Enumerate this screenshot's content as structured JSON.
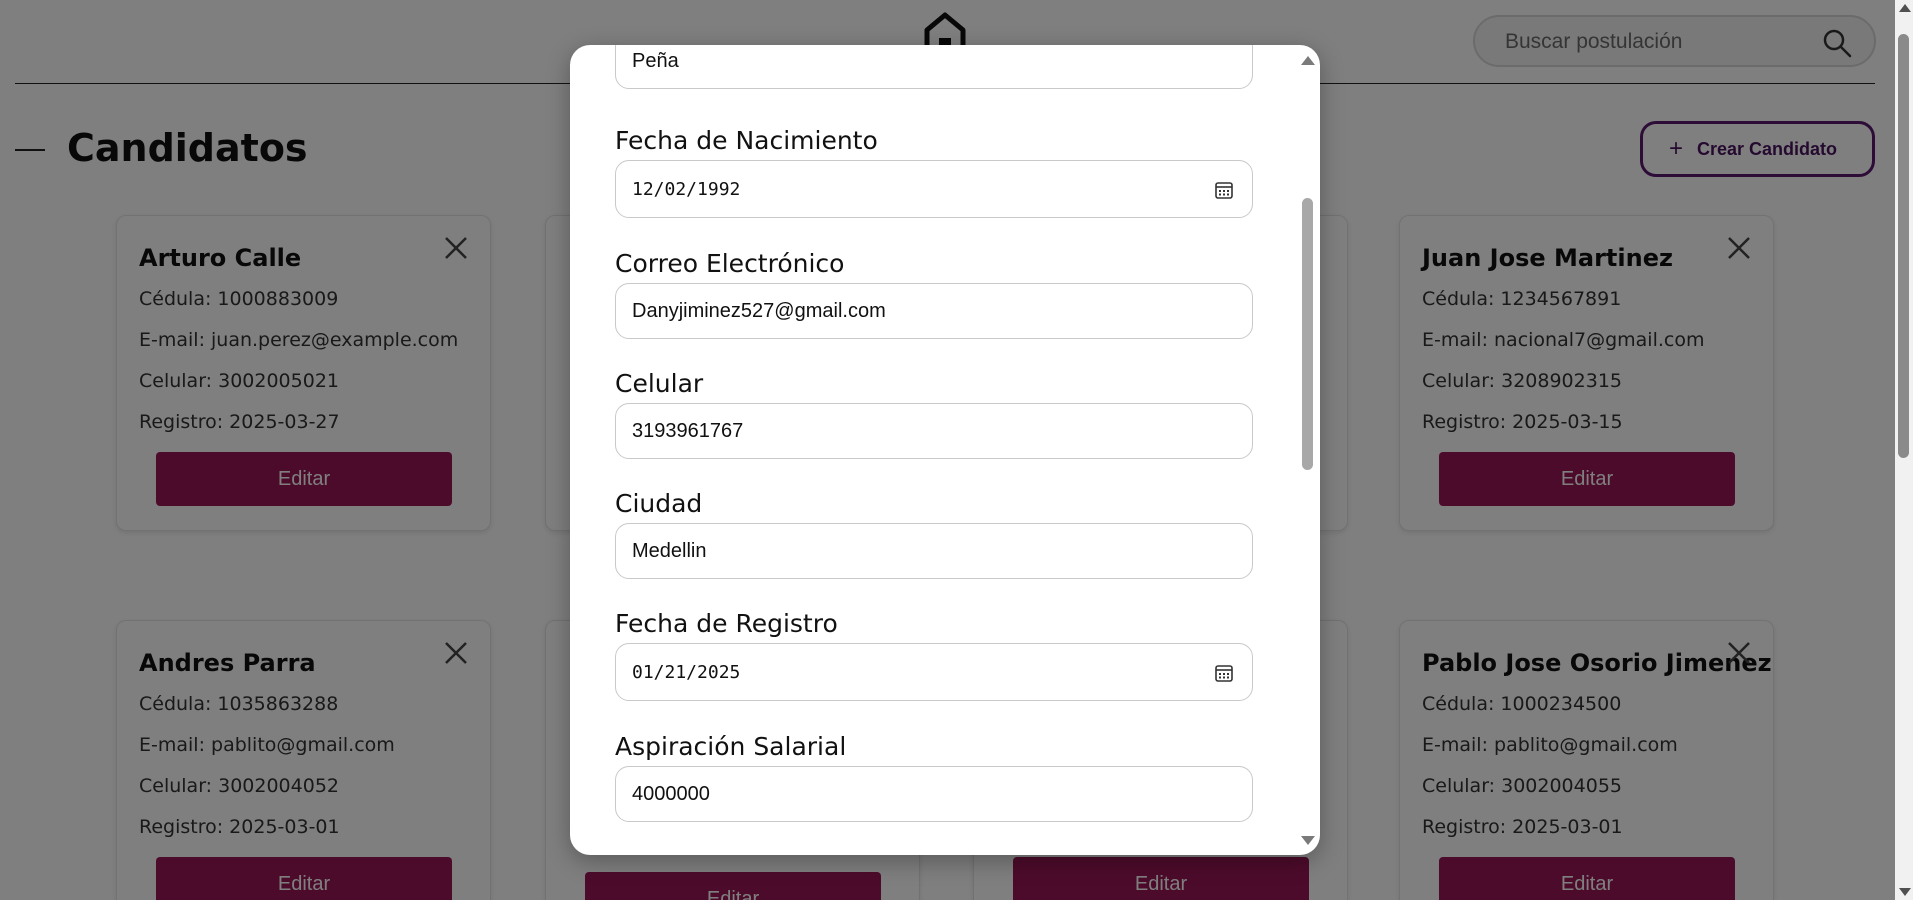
{
  "header": {
    "search_placeholder": "Buscar postulación",
    "page_title": "Candidatos",
    "create_label": "Crear Candidato"
  },
  "cards": [
    {
      "name": "Arturo Calle",
      "cedula": "Cédula: 1000883009",
      "email": "E-mail: juan.perez@example.com",
      "celular": "Celular: 3002005021",
      "registro": "Registro: 2025-03-27",
      "edit": "Editar"
    },
    {
      "name": "Juan Jose Martinez",
      "cedula": "Cédula: 1234567891",
      "email": "E-mail: nacional7@gmail.com",
      "celular": "Celular: 3208902315",
      "registro": "Registro: 2025-03-15",
      "edit": "Editar"
    },
    {
      "name": "Andres Parra",
      "cedula": "Cédula: 1035863288",
      "email": "E-mail: pablito@gmail.com",
      "celular": "Celular: 3002004052",
      "registro": "Registro: 2025-03-01",
      "edit": "Editar"
    },
    {
      "name": "Pablo Jose Osorio Jimenez",
      "cedula": "Cédula: 1000234500",
      "email": "E-mail: pablito@gmail.com",
      "celular": "Celular: 3002004055",
      "registro": "Registro: 2025-03-01",
      "edit": "Editar"
    }
  ],
  "hidden_cards": {
    "edit": "Editar"
  },
  "modal": {
    "apellido_value": "Peña",
    "fecha_nacimiento_label": "Fecha de Nacimiento",
    "fecha_nacimiento_value": "12/02/1992",
    "correo_label": "Correo Electrónico",
    "correo_value": "Danyjiminez527@gmail.com",
    "celular_label": "Celular",
    "celular_value": "3193961767",
    "ciudad_label": "Ciudad",
    "ciudad_value": "Medellin",
    "fecha_registro_label": "Fecha de Registro",
    "fecha_registro_value": "01/21/2025",
    "aspiracion_label": "Aspiración Salarial",
    "aspiracion_value": "4000000"
  },
  "colors": {
    "edit_button": "#9b1657",
    "create_border": "#5a1a6e",
    "overlay": "rgba(0,0,0,0.5)"
  },
  "icons": [
    "home-icon",
    "search-icon",
    "plus-icon",
    "close-icon",
    "calendar-icon"
  ]
}
